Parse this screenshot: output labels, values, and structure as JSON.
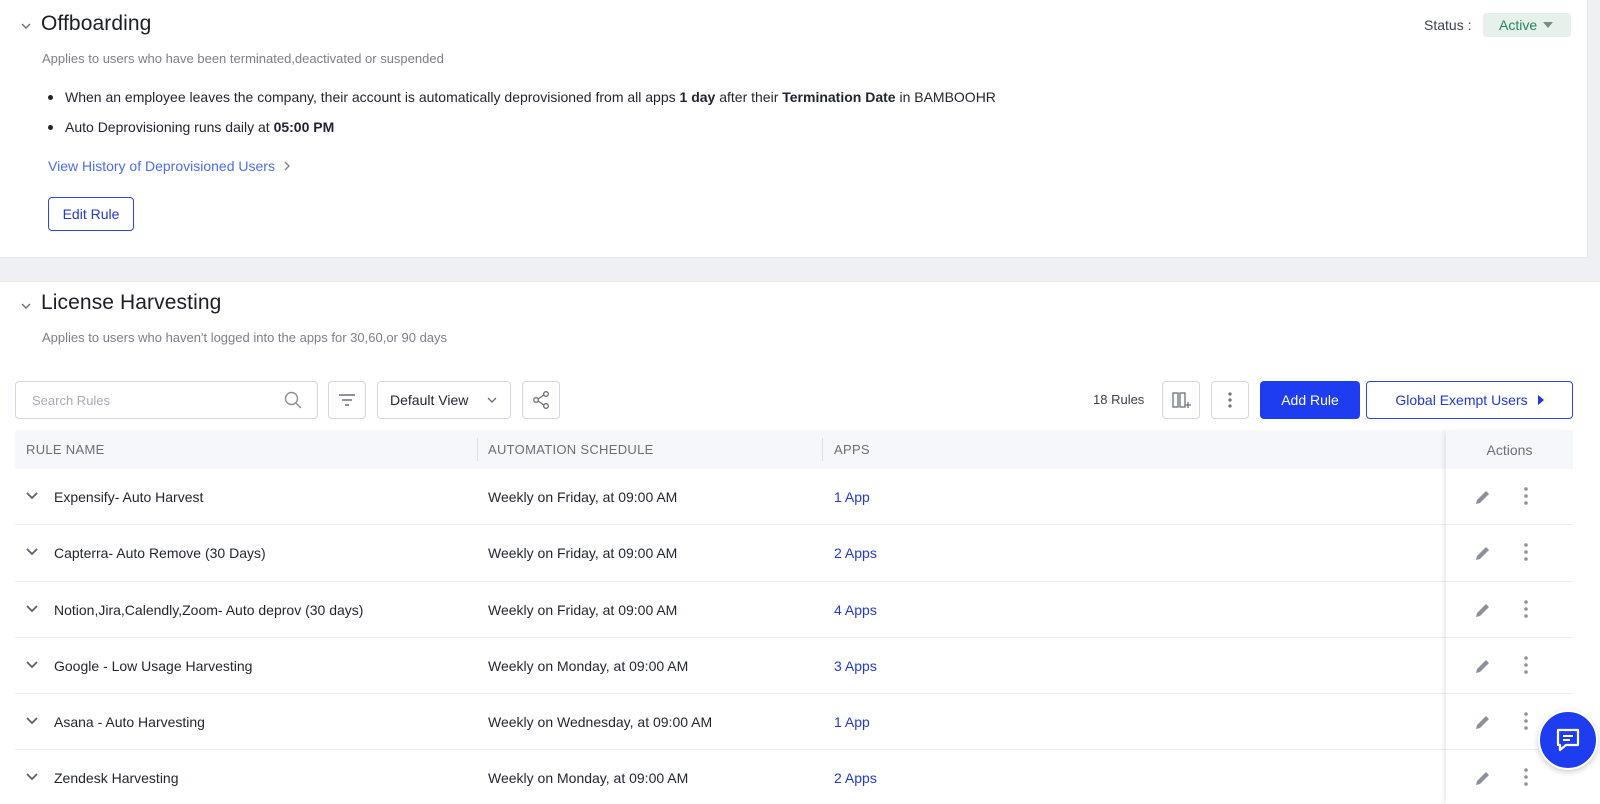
{
  "offboarding": {
    "title": "Offboarding",
    "subtitle": "Applies to users who have been terminated,deactivated or suspended",
    "status_label": "Status :",
    "status_value": "Active",
    "bullet1": {
      "pre": "When an employee leaves the company, their account is automatically deprovisioned from all apps ",
      "bold1": "1 day",
      "mid": " after their ",
      "bold2": "Termination Date",
      "post": " in BAMBOOHR"
    },
    "bullet2": {
      "pre": "Auto Deprovisioning runs daily at ",
      "bold": "05:00 PM"
    },
    "history_link": "View History of Deprovisioned Users",
    "edit_button": "Edit Rule"
  },
  "harvest": {
    "title": "License Harvesting",
    "subtitle": "Applies to users who haven't logged into the apps for 30,60,or 90 days",
    "search_placeholder": "Search Rules",
    "view_label": "Default View",
    "rules_count": "18 Rules",
    "add_rule": "Add Rule",
    "global_exempt": "Global Exempt Users",
    "columns": {
      "rule_name": "RULE NAME",
      "schedule": "AUTOMATION SCHEDULE",
      "apps": "APPS",
      "actions": "Actions"
    },
    "rows": [
      {
        "name": "Expensify- Auto Harvest",
        "schedule": "Weekly on Friday, at 09:00 AM",
        "apps": "1 App"
      },
      {
        "name": "Capterra- Auto Remove (30 Days)",
        "schedule": "Weekly on Friday, at 09:00 AM",
        "apps": "2 Apps"
      },
      {
        "name": "Notion,Jira,Calendly,Zoom- Auto deprov (30 days)",
        "schedule": "Weekly on Friday, at 09:00 AM",
        "apps": "4 Apps"
      },
      {
        "name": "Google - Low Usage Harvesting",
        "schedule": "Weekly on Monday, at 09:00 AM",
        "apps": "3 Apps"
      },
      {
        "name": "Asana - Auto Harvesting",
        "schedule": "Weekly on Wednesday, at 09:00 AM",
        "apps": "1 App"
      },
      {
        "name": "Zendesk Harvesting",
        "schedule": "Weekly on Monday, at 09:00 AM",
        "apps": "2 Apps"
      }
    ]
  },
  "colors": {
    "accent": "#1f3df0",
    "link": "#4a6cf7",
    "status_green": "#24875a",
    "status_bg": "#e7f1ec"
  },
  "icons": [
    "chevron-down-icon",
    "chevron-right-icon",
    "search-icon",
    "filter-icon",
    "share-icon",
    "columns-icon",
    "kebab-icon",
    "pencil-icon",
    "chat-icon"
  ]
}
